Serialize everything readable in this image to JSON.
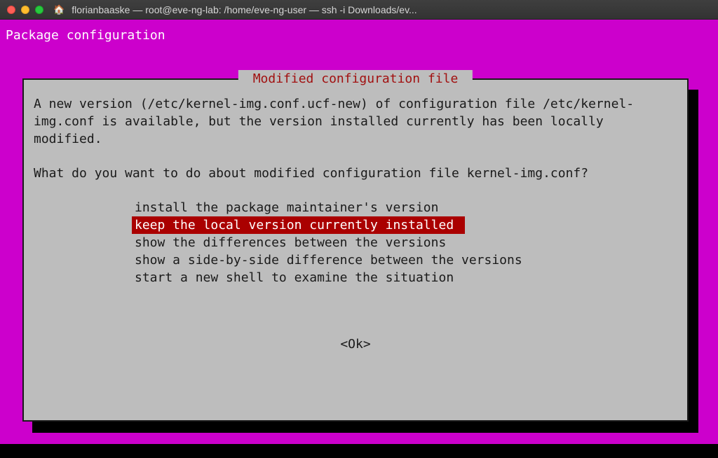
{
  "window": {
    "title": "florianbaaske — root@eve-ng-lab: /home/eve-ng-user — ssh -i Downloads/ev..."
  },
  "screen": {
    "header": "Package configuration"
  },
  "dialog": {
    "title": " Modified configuration file ",
    "body": "A new version (/etc/kernel-img.conf.ucf-new) of configuration file /etc/kernel-img.conf is available, but the version installed currently has been locally modified.",
    "question": "What do you want to do about modified configuration file kernel-img.conf?",
    "options": [
      "install the package maintainer's version",
      "keep the local version currently installed",
      "show the differences between the versions",
      "show a side-by-side difference between the versions",
      "start a new shell to examine the situation"
    ],
    "selected_index": 1,
    "ok_label": "<Ok>"
  },
  "colors": {
    "magenta": "#cc00cc",
    "dialog_bg": "#bdbdbd",
    "dialog_fg": "#1a1a1a",
    "title_red": "#a11010",
    "highlight_bg": "#aa0000",
    "highlight_fg": "#ffffff"
  }
}
